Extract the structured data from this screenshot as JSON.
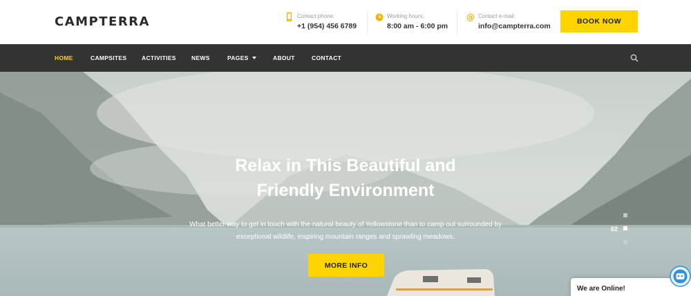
{
  "brand": {
    "logo_text": "CAMPTERRA",
    "accent_color": "#ffd400"
  },
  "header": {
    "contact_phone": {
      "label": "Contact phone:",
      "value": "+1 (954) 456 6789",
      "icon": "phone-icon"
    },
    "working_hours": {
      "label": "Working hours:",
      "value": "8:00 am - 6:00 pm",
      "icon": "clock-icon"
    },
    "contact_email": {
      "label": "Contact e-mail:",
      "value": "info@campterra.com",
      "icon": "at-icon"
    },
    "book_label": "BOOK NOW"
  },
  "nav": {
    "items": [
      {
        "label": "HOME",
        "active": true
      },
      {
        "label": "CAMPSITES"
      },
      {
        "label": "ACTIVITIES"
      },
      {
        "label": "NEWS"
      },
      {
        "label": "PAGES",
        "dropdown": true
      },
      {
        "label": "ABOUT"
      },
      {
        "label": "CONTACT"
      }
    ],
    "search_icon": "search-icon",
    "background": "#333333"
  },
  "hero": {
    "title_line1": "Relax in This Beautiful and",
    "title_line2": "Friendly Environment",
    "subtitle_line1": "What better way to get in touch with the natural beauty of Yellowstone than to camp out surrounded by",
    "subtitle_line2": "exceptional wildlife, inspiring mountain ranges and sprawling meadows.",
    "button_label": "MORE INFO",
    "slider": {
      "current_label": "02",
      "total_slides": 3,
      "active_index": 1
    }
  },
  "chat": {
    "label": "We are Online!",
    "icon": "chat-bot-icon"
  }
}
